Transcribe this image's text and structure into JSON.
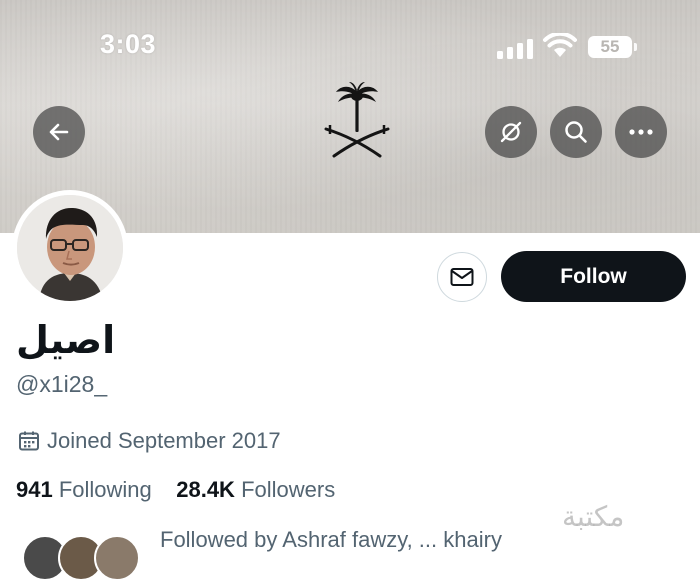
{
  "status_bar": {
    "time": "3:03",
    "battery": "55"
  },
  "header": {
    "back_icon": "arrow-left-icon",
    "action_icons": [
      "notification-off-icon",
      "search-icon",
      "more-icon"
    ],
    "banner_emblem": "palm-and-swords-emblem"
  },
  "profile": {
    "display_name": "اصيل",
    "handle": "@x1i28_",
    "joined": "Joined September 2017",
    "following_count": "941",
    "following_label": "Following",
    "followers_count": "28.4K",
    "followers_label": "Followers",
    "followed_by": "Followed by Ashraf fawzy, ... khairy"
  },
  "actions": {
    "message_icon": "envelope-icon",
    "follow_label": "Follow"
  },
  "colors": {
    "primary_text": "#0f1419",
    "secondary_text": "#536471",
    "button_dark": "#0f1419",
    "border": "#cfd9de"
  },
  "watermark": "مكتبة"
}
